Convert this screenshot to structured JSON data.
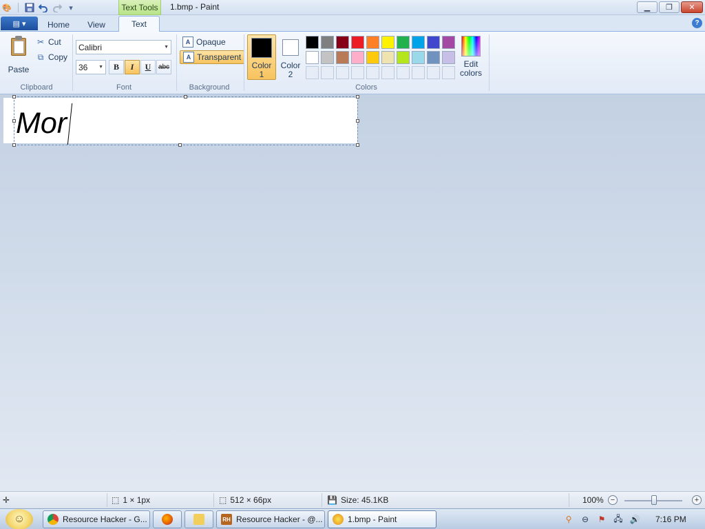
{
  "window": {
    "title": "1.bmp - Paint",
    "contextual_tab_group": "Text Tools"
  },
  "qat": {
    "icons": [
      "paint-app-icon",
      "save-icon",
      "undo-icon",
      "redo-icon",
      "customize-dropdown-icon"
    ]
  },
  "tabs": [
    {
      "label": "Home",
      "active": false
    },
    {
      "label": "View",
      "active": false
    },
    {
      "label": "Text",
      "active": true
    }
  ],
  "ribbon": {
    "clipboard": {
      "label": "Clipboard",
      "paste": "Paste",
      "cut": "Cut",
      "copy": "Copy"
    },
    "font": {
      "label": "Font",
      "family": "Calibri",
      "size": "36",
      "bold": {
        "glyph": "B",
        "on": false
      },
      "italic": {
        "glyph": "I",
        "on": true
      },
      "underline": {
        "glyph": "U",
        "on": false
      },
      "strikethrough": {
        "glyph": "abc",
        "on": false
      }
    },
    "background": {
      "label": "Background",
      "opaque": "Opaque",
      "transparent": "Transparent",
      "selected": "Transparent"
    },
    "colors": {
      "label": "Colors",
      "color1": {
        "label_line1": "Color",
        "label_line2": "1",
        "value": "#000000"
      },
      "color2": {
        "label_line1": "Color",
        "label_line2": "2",
        "value": "#ffffff"
      },
      "palette": [
        "#000000",
        "#7f7f7f",
        "#880015",
        "#ed1c24",
        "#ff7f27",
        "#fff200",
        "#22b14c",
        "#00a2e8",
        "#3f48cc",
        "#a349a4",
        "#ffffff",
        "#c3c3c3",
        "#b97a57",
        "#ffaec9",
        "#ffc90e",
        "#efe4b0",
        "#b5e61d",
        "#99d9ea",
        "#7092be",
        "#c8bfe7",
        "",
        "",
        "",
        "",
        "",
        "",
        "",
        "",
        "",
        ""
      ],
      "edit_colors_line1": "Edit",
      "edit_colors_line2": "colors"
    }
  },
  "canvas": {
    "text": "Mor",
    "text_color": "#000000",
    "background": "#ffffff"
  },
  "statusbar": {
    "cursor_pos": "1 × 1px",
    "selection_size": "512 × 66px",
    "file_size": "Size: 45.1KB",
    "zoom": "100%",
    "zoom_percent": 100
  },
  "taskbar": {
    "tasks": [
      {
        "label": "Resource Hacker - G...",
        "icon": "chrome-icon"
      },
      {
        "label": "",
        "icon": "firefox-icon"
      },
      {
        "label": "",
        "icon": "folder-icon"
      },
      {
        "label": "Resource Hacker - @...",
        "icon": "resource-hacker-icon"
      },
      {
        "label": "1.bmp - Paint",
        "icon": "paint-icon",
        "active": true
      }
    ],
    "clock": "7:16 PM"
  }
}
